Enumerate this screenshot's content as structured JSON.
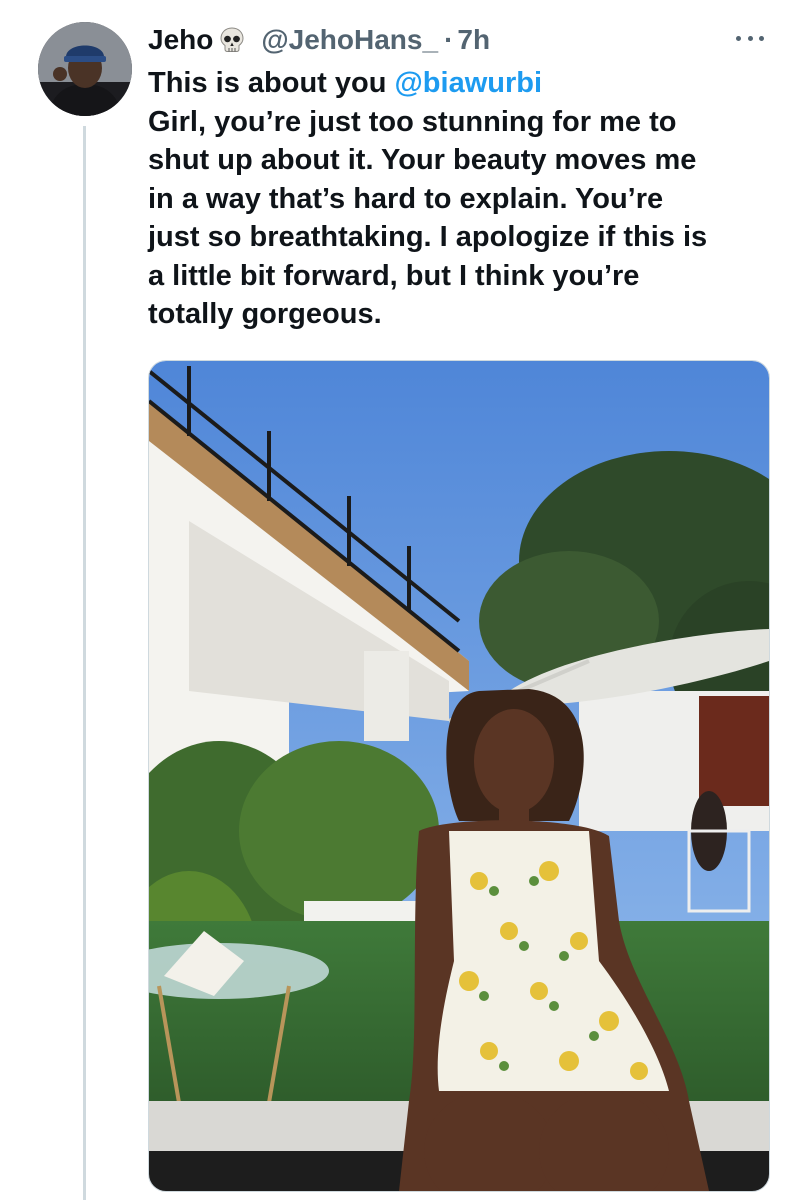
{
  "tweet": {
    "display_name": "Jeho",
    "name_emoji_icon": "skull-icon",
    "handle": "@JehoHans_",
    "separator": "·",
    "time": "7h",
    "more_icon": "ellipsis-icon",
    "line1_prefix": "This is about you ",
    "mention": "@biawurbi",
    "text_lines": [
      "Girl, you’re just too stunning for me to",
      "shut up about it. Your beauty moves me",
      "in a way that’s hard to explain. You’re",
      "just so breathtaking. I apologize if this is",
      "a little bit forward, but I think you’re",
      "totally gorgeous."
    ]
  },
  "colors": {
    "text": "#0f1419",
    "muted": "#536471",
    "link": "#1d9bf0",
    "thread_line": "#cfd9de"
  }
}
